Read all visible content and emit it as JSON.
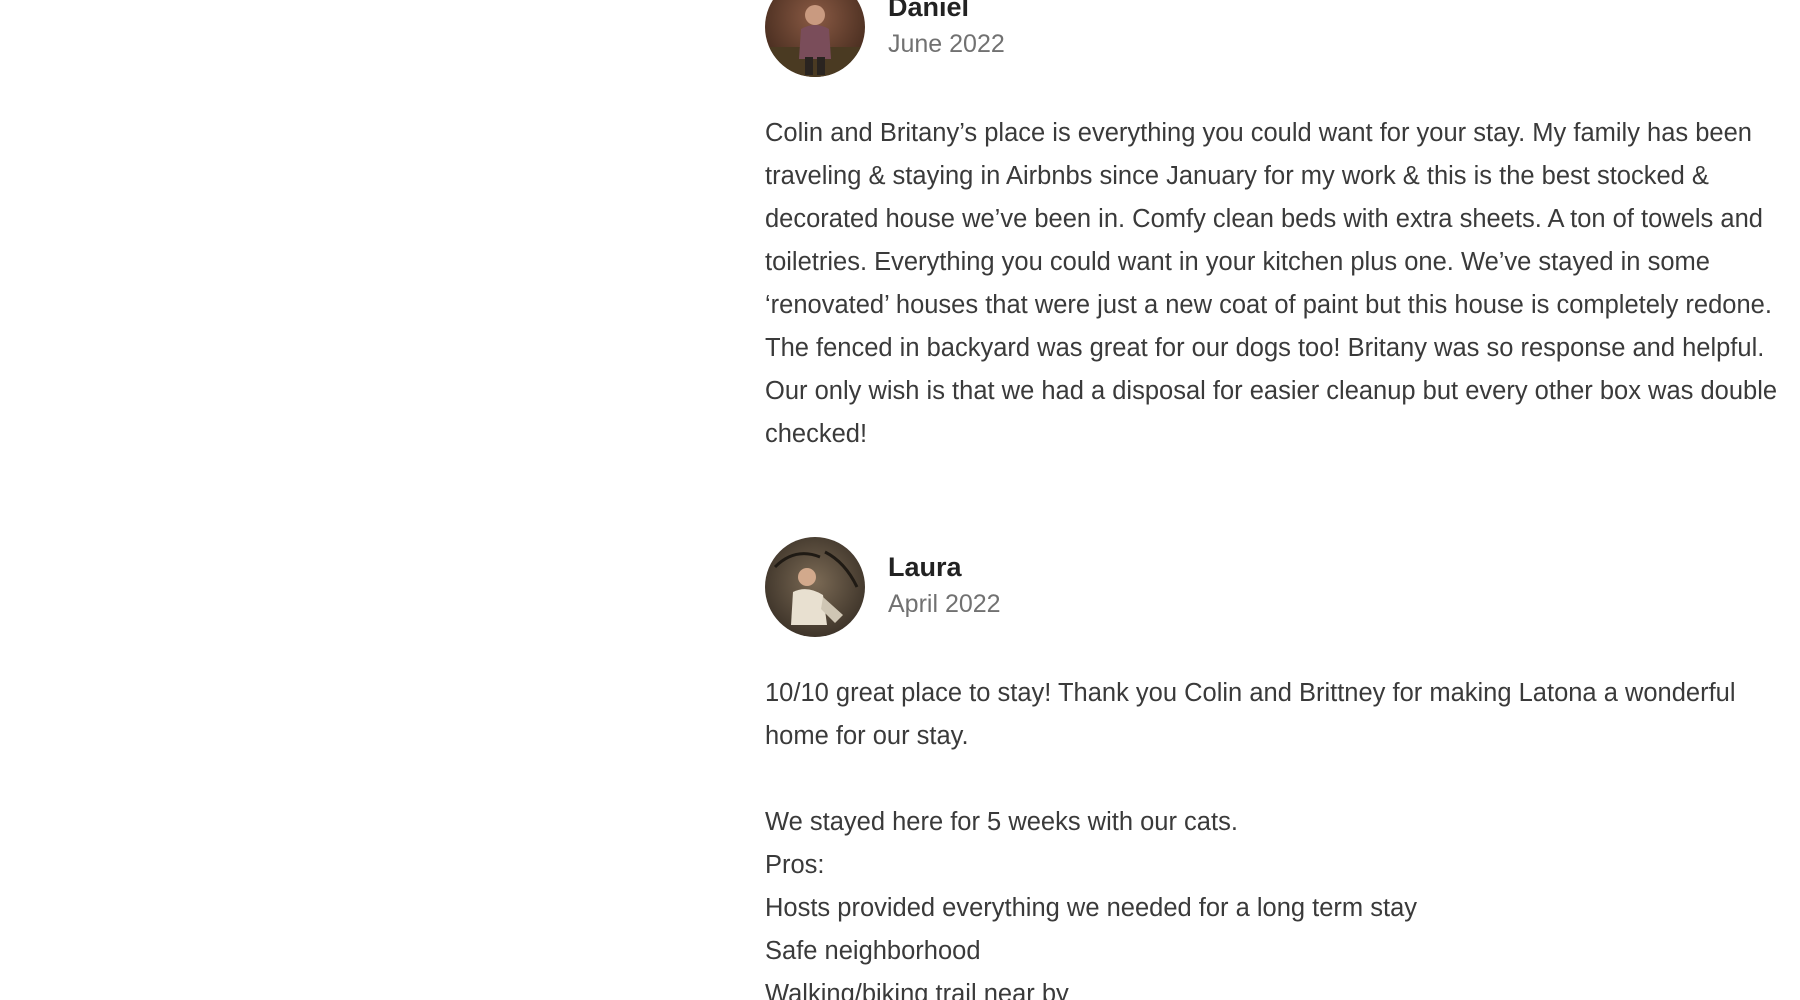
{
  "reviews": [
    {
      "name": "Daniel",
      "date": "June 2022",
      "paragraphs": [
        "Colin and Britany’s place is everything you could want for your stay. My family has been traveling & staying in Airbnbs since January for my work & this is the best stocked & decorated house we’ve been in. Comfy clean beds with extra sheets. A ton of towels and toiletries. Everything you could want in your kitchen plus one. We’ve stayed in some ‘renovated’ houses that were just a new coat of paint but this house is completely redone. The fenced in backyard was great for our dogs too! Britany was so response and helpful. Our only wish is that we had a disposal for easier cleanup but every other box was double checked!"
      ]
    },
    {
      "name": "Laura",
      "date": "April 2022",
      "paragraphs": [
        "10/10 great place to stay! Thank you Colin and Brittney for making Latona a wonderful home for our stay.",
        "We stayed here for 5 weeks with our cats.",
        "Pros:",
        "Hosts provided everything we needed for a long term stay",
        "Safe neighborhood",
        "Walking/biking trail near by"
      ]
    }
  ],
  "icons": {
    "avatar_daniel": "avatar-photo",
    "avatar_laura": "avatar-photo"
  }
}
